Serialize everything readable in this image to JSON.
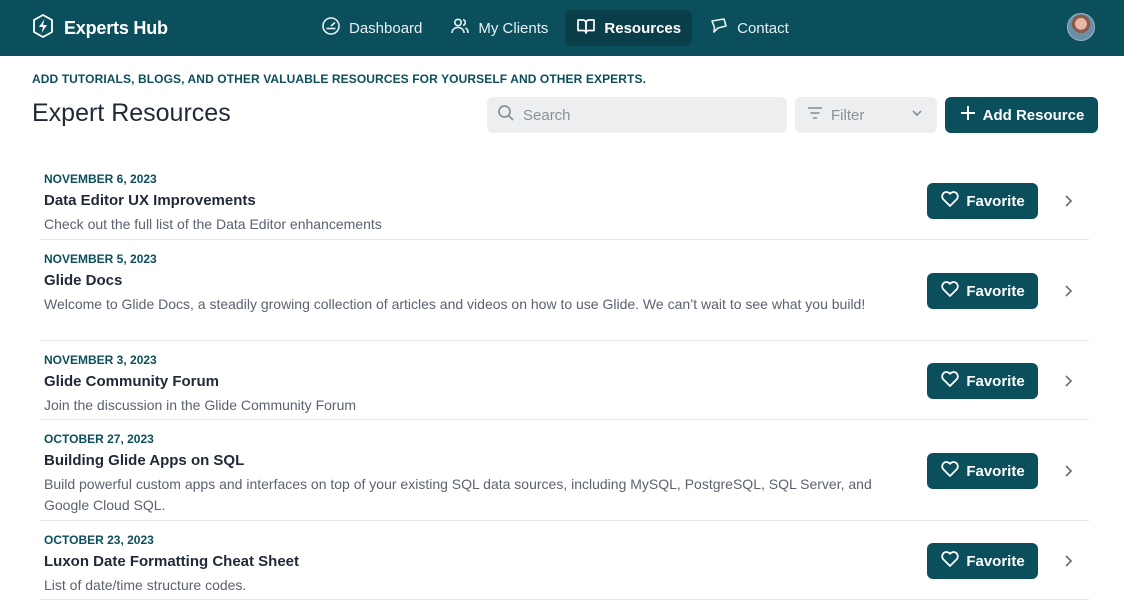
{
  "brand": {
    "name": "Experts Hub"
  },
  "nav": [
    {
      "label": "Dashboard",
      "icon": "gauge-icon",
      "active": false
    },
    {
      "label": "My Clients",
      "icon": "users-icon",
      "active": false
    },
    {
      "label": "Resources",
      "icon": "book-open-icon",
      "active": true
    },
    {
      "label": "Contact",
      "icon": "message-icon",
      "active": false
    }
  ],
  "header": {
    "eyebrow": "ADD TUTORIALS, BLOGS, AND OTHER VALUABLE RESOURCES FOR YOURSELF AND OTHER EXPERTS.",
    "title": "Expert Resources",
    "search_placeholder": "Search",
    "filter_label": "Filter",
    "add_label": "Add Resource"
  },
  "colors": {
    "primary": "#0b4f5c",
    "surface": "#eceef0",
    "date_text": "#0b4f5c"
  },
  "favorite_label": "Favorite",
  "resources": [
    {
      "date": "NOVEMBER 6, 2023",
      "title": "Data Editor UX Improvements",
      "description": "Check out the full list of the Data Editor enhancements"
    },
    {
      "date": "NOVEMBER 5, 2023",
      "title": "Glide Docs",
      "description": "Welcome to Glide Docs, a steadily growing collection of articles and videos on how to use Glide. We can’t wait to see what you build!"
    },
    {
      "date": "NOVEMBER 3, 2023",
      "title": "Glide Community Forum",
      "description": "Join the discussion in the Glide Community Forum"
    },
    {
      "date": "OCTOBER 27, 2023",
      "title": "Building Glide Apps on SQL",
      "description": "Build powerful custom apps and interfaces on top of your existing SQL data sources, including MySQL, PostgreSQL, SQL Server, and Google Cloud SQL."
    },
    {
      "date": "OCTOBER 23, 2023",
      "title": "Luxon Date Formatting Cheat Sheet",
      "description": "List of date/time structure codes."
    }
  ]
}
